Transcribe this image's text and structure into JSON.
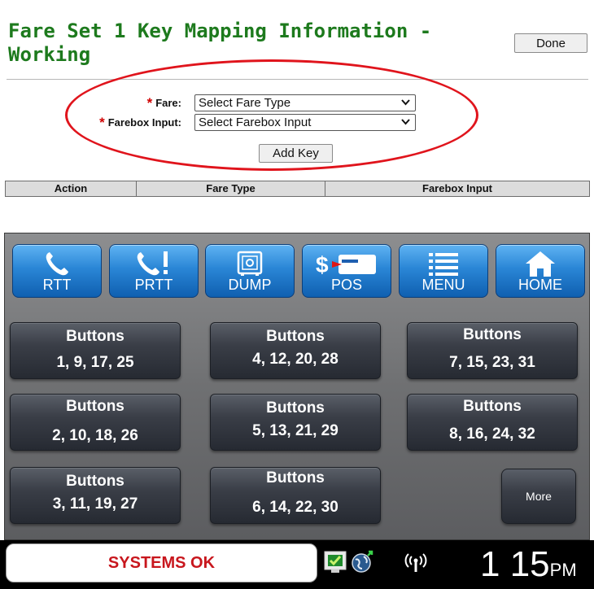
{
  "header": {
    "title": "Fare Set 1 Key Mapping Information - Working",
    "done_label": "Done"
  },
  "form": {
    "fare_label": "Fare:",
    "fare_value": "Select Fare Type",
    "farebox_label": "Farebox Input:",
    "farebox_value": "Select Farebox Input",
    "required_mark": "*",
    "add_key_label": "Add Key"
  },
  "table": {
    "columns": [
      "Action",
      "Fare Type",
      "Farebox Input"
    ]
  },
  "device": {
    "top_buttons": [
      {
        "label": "RTT",
        "icon": "phone-icon"
      },
      {
        "label": "PRTT",
        "icon": "phone-alert-icon"
      },
      {
        "label": "DUMP",
        "icon": "safe-icon"
      },
      {
        "label": "POS",
        "icon": "pos-card-icon"
      },
      {
        "label": "MENU",
        "icon": "list-menu-icon"
      },
      {
        "label": "HOME",
        "icon": "home-icon"
      }
    ],
    "key_buttons": [
      {
        "title": "Buttons",
        "numbers": "1, 9, 17, 25"
      },
      {
        "title": "Buttons",
        "numbers": "4, 12, 20, 28"
      },
      {
        "title": "Buttons",
        "numbers": "7, 15, 23, 31"
      },
      {
        "title": "Buttons",
        "numbers": "2, 10, 18, 26"
      },
      {
        "title": "Buttons",
        "numbers": "5, 13, 21, 29"
      },
      {
        "title": "Buttons",
        "numbers": "8, 16, 24, 32"
      },
      {
        "title": "Buttons",
        "numbers": "3, 11, 19, 27"
      },
      {
        "title": "Buttons",
        "numbers": "6, 14, 22, 30"
      }
    ],
    "more_label": "More"
  },
  "status": {
    "message": "SYSTEMS OK",
    "time": "1 15",
    "ampm": "PM",
    "icons": [
      "monitor-check-icon",
      "globe-icon",
      "wireless-signal-icon"
    ]
  },
  "colors": {
    "title_green": "#1d7a1d",
    "required_red": "#d00000",
    "highlight_red": "#e0141c",
    "device_blue": "#2a86d6",
    "status_red": "#c8161d"
  }
}
